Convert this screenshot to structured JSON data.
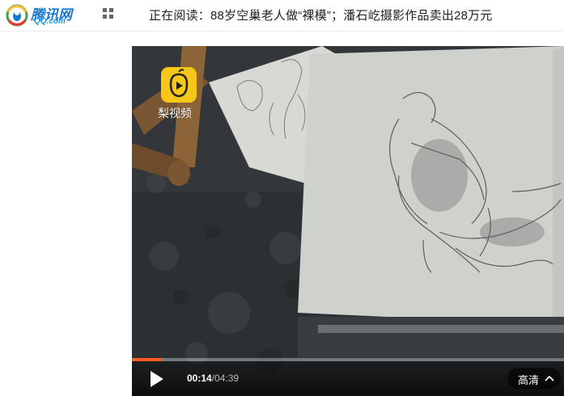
{
  "header": {
    "logo": {
      "text": "腾讯网",
      "sub": "QQ.com"
    },
    "menu_icon": "grid-icon",
    "reading_label": "正在阅读：",
    "reading_title": "88岁空巢老人做“裸模”；潘石屹摄影作品卖出28万元"
  },
  "video": {
    "watermark": "梨视频",
    "watermark_icon": "pear-play-icon",
    "progress": 0.07,
    "current_time": "00:14",
    "separator": "/",
    "duration": "04:39",
    "quality_label": "高清",
    "play_icon": "play-icon",
    "chevron_icon": "chevron-up-icon"
  },
  "colors": {
    "brand_blue": "#1a78d0",
    "progress_orange": "#ff5a1f",
    "watermark_yellow": "#f6c619"
  }
}
